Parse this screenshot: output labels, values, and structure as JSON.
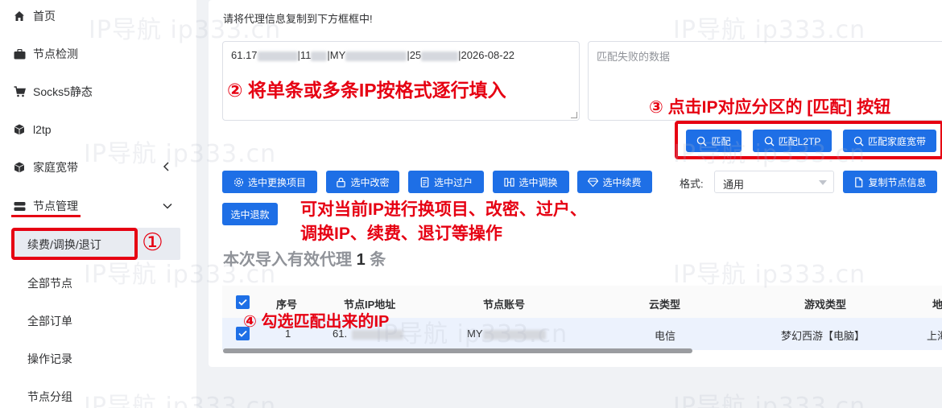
{
  "watermark": "IP导航 ip333.cn",
  "sidebar": {
    "items": [
      {
        "label": "首页",
        "icon": "home-icon"
      },
      {
        "label": "节点检测",
        "icon": "briefcase-icon"
      },
      {
        "label": "Socks5静态",
        "icon": "cart-icon"
      },
      {
        "label": "l2tp",
        "icon": "cube-icon"
      },
      {
        "label": "家庭宽带",
        "icon": "cube-icon"
      },
      {
        "label": "节点管理",
        "icon": "server-icon"
      }
    ],
    "sub_items": [
      "续费/调换/退订",
      "全部节点",
      "全部订单",
      "操作记录",
      "节点分组"
    ]
  },
  "main": {
    "hint": "请将代理信息复制到下方框框中!",
    "input_value": "61.17 |11 |MY |25 |2026-08-22",
    "input_parts": [
      "61.17",
      "|11",
      "|MY",
      "|25",
      "|2026-08-22"
    ],
    "fail_placeholder": "匹配失败的数据",
    "match_buttons": [
      "匹配",
      "匹配L2TP",
      "匹配家庭宽带"
    ],
    "action_buttons": [
      "选中更换项目",
      "选中改密",
      "选中过户",
      "选中调换",
      "选中续费",
      "选中退款"
    ],
    "format_label": "格式:",
    "format_value": "通用",
    "copy_button": "复制节点信息",
    "import_prefix": "本次导入有效代理",
    "import_count": "1",
    "import_suffix": "条"
  },
  "table": {
    "headers": [
      "序号",
      "节点IP地址",
      "节点账号",
      "云类型",
      "游戏类型",
      "地"
    ],
    "rows": [
      {
        "index": "1",
        "ip": "61.",
        "account": "MY",
        "cloud": "电信",
        "game": "梦幻西游【电脑】",
        "region": "上海"
      }
    ]
  },
  "annotations": {
    "step1": "①",
    "step2": "② 将单条或多条IP按格式逐行填入",
    "step3": "③ 点击IP对应分区的 [匹配] 按钮",
    "step4": "④ 勾选匹配出来的IP",
    "ops_line1": "可对当前IP进行换项目、改密、过户、",
    "ops_line2": "调换IP、续费、退订等操作"
  },
  "colors": {
    "primary": "#1e6fe6",
    "annotation": "#e60012"
  }
}
